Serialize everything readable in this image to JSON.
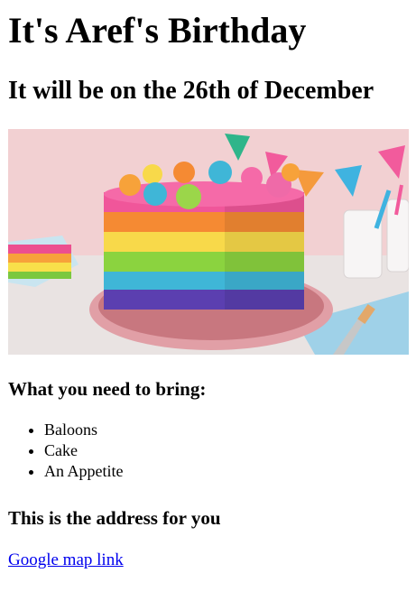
{
  "title": "It's Aref's Birthday",
  "subtitle": "It will be on the 26th of December",
  "image": {
    "icon": "birthday-cake-image"
  },
  "bring_heading": "What you need to bring:",
  "bring_items": [
    "Baloons",
    "Cake",
    "An Appetite"
  ],
  "address_heading": "This is the address for you",
  "map_link_label": "Google map link",
  "colors": {
    "link": "#0000ee",
    "text": "#000000",
    "background": "#ffffff"
  }
}
